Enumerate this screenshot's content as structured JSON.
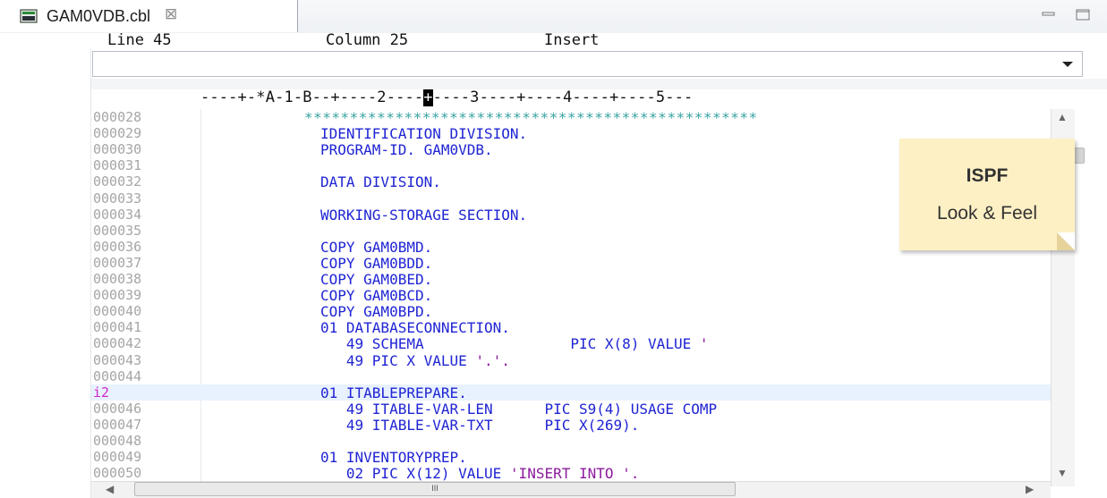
{
  "tab": {
    "label": "GAM0VDB.cbl",
    "close_glyph": "⊠"
  },
  "status": {
    "line": "Line 45",
    "column": "Column 25",
    "mode": "Insert"
  },
  "command": {
    "value": ""
  },
  "ruler": {
    "before_cursor": "----+-*A-1-B--+----2----",
    "cursor_char": "+",
    "after_cursor": "----3----+----4----+----5---"
  },
  "lines": [
    {
      "num": "000028",
      "code": "**************************************************",
      "kind": "stars"
    },
    {
      "num": "000029",
      "code": "IDENTIFICATION DIVISION."
    },
    {
      "num": "000030",
      "code": "PROGRAM-ID. GAM0VDB."
    },
    {
      "num": "000031",
      "code": ""
    },
    {
      "num": "000032",
      "code": "DATA DIVISION."
    },
    {
      "num": "000033",
      "code": ""
    },
    {
      "num": "000034",
      "code": "WORKING-STORAGE SECTION."
    },
    {
      "num": "000035",
      "code": ""
    },
    {
      "num": "000036",
      "code": "COPY GAM0BMD."
    },
    {
      "num": "000037",
      "code": "COPY GAM0BDD."
    },
    {
      "num": "000038",
      "code": "COPY GAM0BED."
    },
    {
      "num": "000039",
      "code": "COPY GAM0BCD."
    },
    {
      "num": "000040",
      "code": "COPY GAM0BPD."
    },
    {
      "num": "000041",
      "code": "01 DATABASECONNECTION."
    },
    {
      "num": "000042",
      "code": "   49 SCHEMA                 PIC X(8) VALUE '"
    },
    {
      "num": "000043",
      "code": "   49 PIC X VALUE '.'."
    },
    {
      "num": "000044",
      "code": ""
    },
    {
      "num": "i2",
      "code": "01 ITABLEPREPARE.",
      "current": true
    },
    {
      "num": "000046",
      "code": "   49 ITABLE-VAR-LEN      PIC S9(4) USAGE COMP"
    },
    {
      "num": "000047",
      "code": "   49 ITABLE-VAR-TXT      PIC X(269)."
    },
    {
      "num": "000048",
      "code": ""
    },
    {
      "num": "000049",
      "code": "01 INVENTORYPREP."
    },
    {
      "num": "000050",
      "code": "   02 PIC X(12) VALUE 'INSERT INTO '."
    }
  ],
  "hscroll_thumb": "III",
  "note": {
    "title": "ISPF",
    "subtitle": "Look & Feel"
  },
  "colors": {
    "code": "#1f24d3",
    "stars": "#3aa3a3",
    "linenum": "#a6a6a6",
    "modified": "#d127d1",
    "note": "#fdf0c4"
  }
}
